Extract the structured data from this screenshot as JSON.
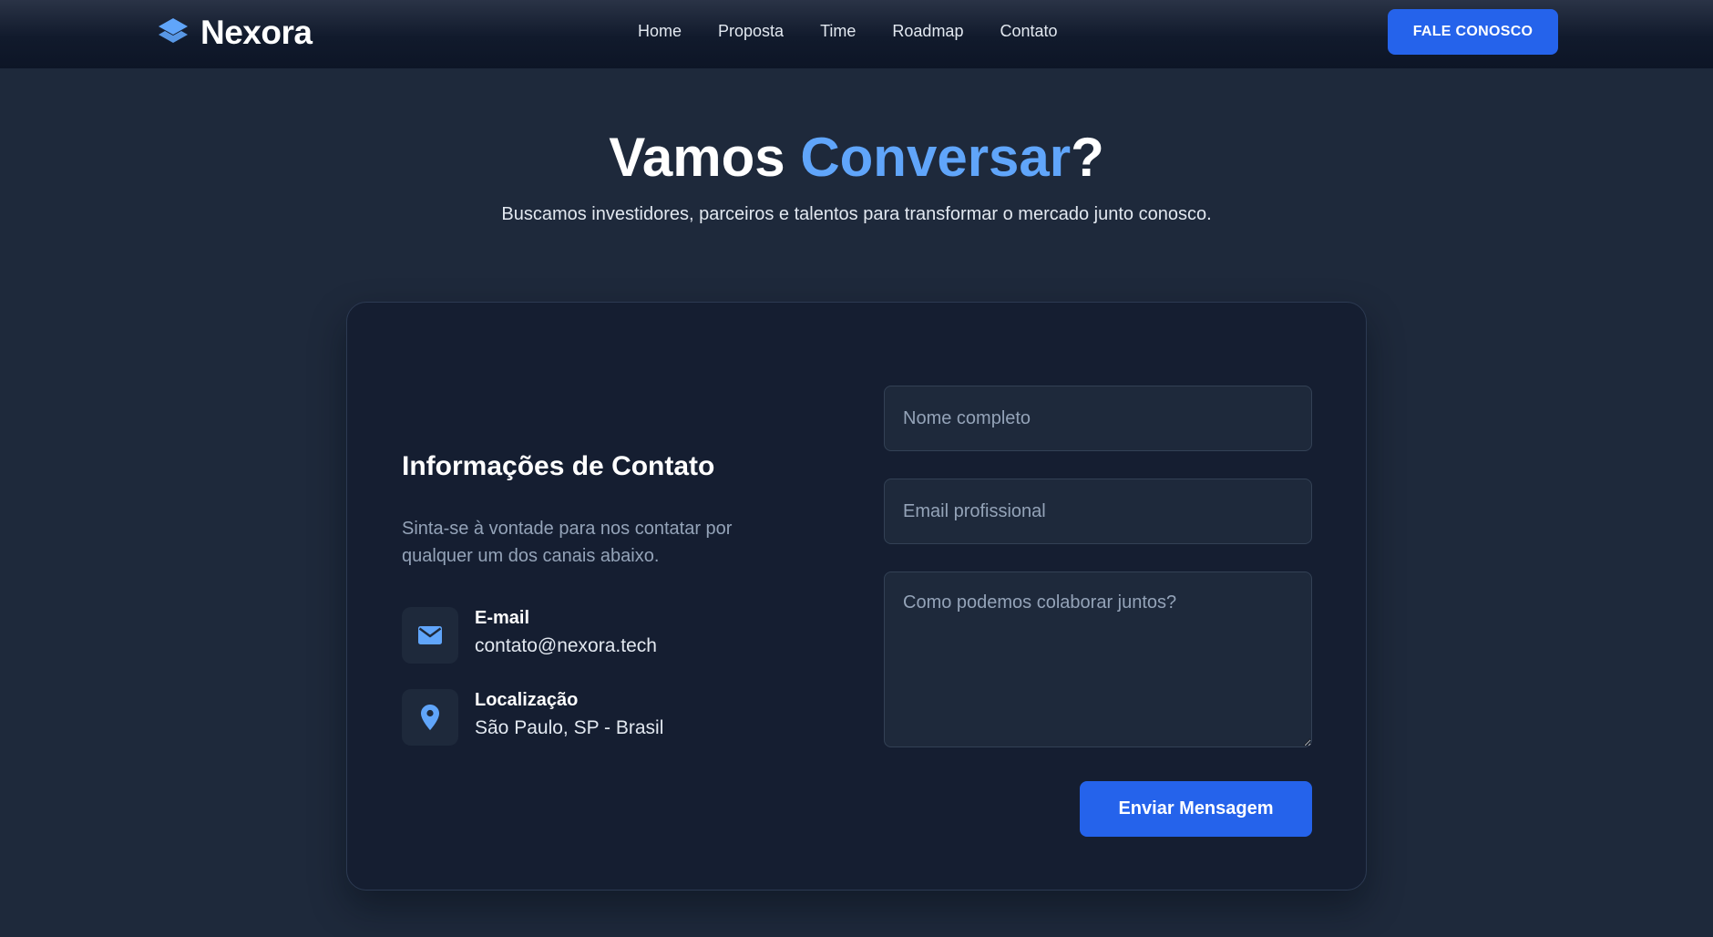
{
  "brand": {
    "name": "Nexora",
    "logo_icon": "layers-icon",
    "logo_color": "#60a5fa"
  },
  "nav": {
    "links": [
      "Home",
      "Proposta",
      "Time",
      "Roadmap",
      "Contato"
    ],
    "cta_label": "FALE CONOSCO"
  },
  "hero": {
    "title_prefix": "Vamos ",
    "title_accent": "Conversar",
    "title_suffix": "?",
    "subtitle": "Buscamos investidores, parceiros e talentos para transformar o mercado junto conosco."
  },
  "contact_info": {
    "title": "Informações de Contato",
    "description": "Sinta-se à vontade para nos contatar por qualquer um dos canais abaixo.",
    "items": [
      {
        "icon": "envelope-icon",
        "label": "E-mail",
        "value": "contato@nexora.tech"
      },
      {
        "icon": "map-pin-icon",
        "label": "Localização",
        "value": "São Paulo, SP - Brasil"
      }
    ]
  },
  "form": {
    "name_placeholder": "Nome completo",
    "email_placeholder": "Email profissional",
    "message_placeholder": "Como podemos colaborar juntos?",
    "submit_label": "Enviar Mensagem"
  },
  "colors": {
    "accent": "#60a5fa",
    "primary_button": "#2563eb",
    "background": "#1e293b",
    "card": "#151e31"
  }
}
